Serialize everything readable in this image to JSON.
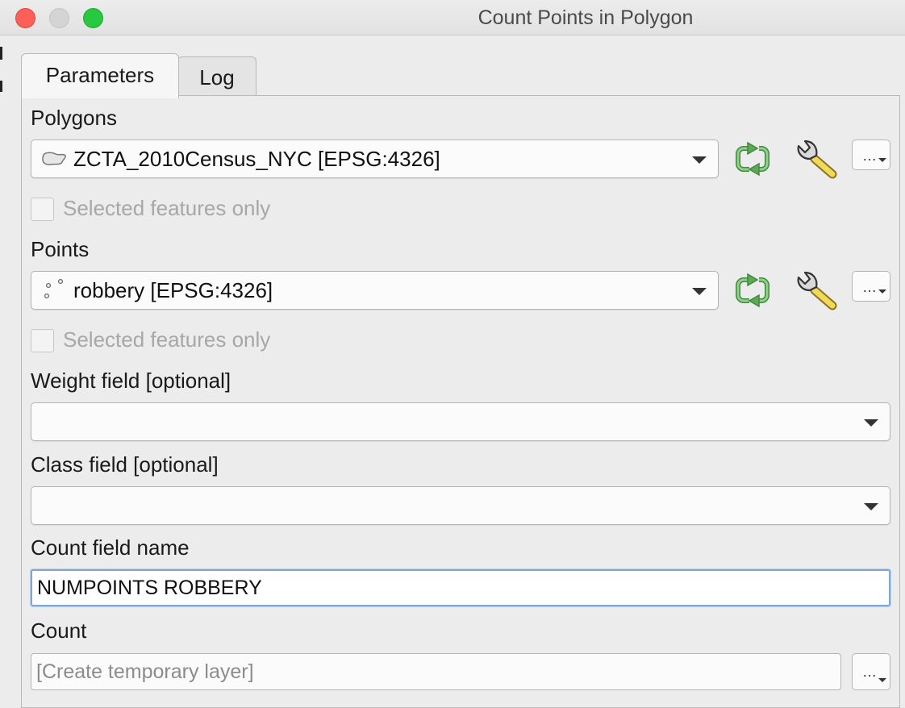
{
  "window": {
    "title": "Count Points in Polygon"
  },
  "tabs": [
    {
      "label": "Parameters",
      "active": true
    },
    {
      "label": "Log",
      "active": false
    }
  ],
  "polygons": {
    "label": "Polygons",
    "value": "ZCTA_2010Census_NYC [EPSG:4326]",
    "layer_icon": "polygon-layer-icon",
    "selected_only_label": "Selected features only",
    "selected_only_checked": false
  },
  "points": {
    "label": "Points",
    "value": "robbery [EPSG:4326]",
    "layer_icon": "point-layer-icon",
    "selected_only_label": "Selected features only",
    "selected_only_checked": false
  },
  "weight_field": {
    "label": "Weight field [optional]",
    "value": ""
  },
  "class_field": {
    "label": "Class field [optional]",
    "value": ""
  },
  "count_field_name": {
    "label": "Count field name",
    "value": "NUMPOINTS ROBBERY"
  },
  "count": {
    "label": "Count",
    "placeholder": "[Create temporary layer]"
  },
  "buttons": {
    "options_label": "…"
  },
  "colors": {
    "close": "#fe5f57",
    "minimize": "#d4d4d4",
    "maximize": "#28c840",
    "iterate_icon": "#5fa85a",
    "focus_border": "#7fa6d8"
  }
}
